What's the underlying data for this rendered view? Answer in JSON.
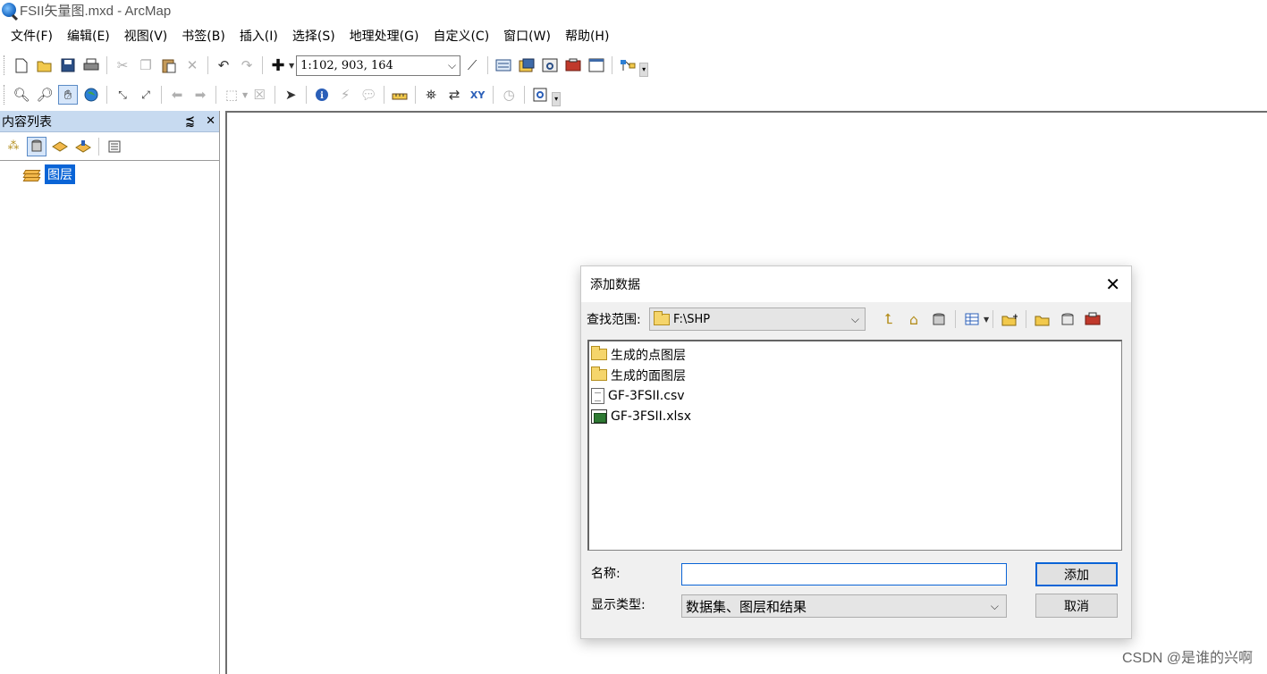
{
  "window": {
    "title": "FSII矢量图.mxd - ArcMap"
  },
  "menu": [
    "文件(F)",
    "编辑(E)",
    "视图(V)",
    "书签(B)",
    "插入(I)",
    "选择(S)",
    "地理处理(G)",
    "自定义(C)",
    "窗口(W)",
    "帮助(H)"
  ],
  "standard_toolbar": {
    "scale": "1:102, 903, 164"
  },
  "toc": {
    "title": "内容列表",
    "pin": "⪷",
    "close": "✕",
    "layer_label": "图层"
  },
  "dialog": {
    "title": "添加数据",
    "look_in_label": "查找范围:",
    "look_in_path": "F:\\SHP",
    "files": [
      {
        "name": "生成的点图层",
        "icon": "folder-icon"
      },
      {
        "name": "生成的面图层",
        "icon": "folder-icon"
      },
      {
        "name": "GF-3FSII.csv",
        "icon": "text-file-icon"
      },
      {
        "name": "GF-3FSII.xlsx",
        "icon": "table-file-icon"
      }
    ],
    "name_label": "名称:",
    "name_value": "",
    "type_label": "显示类型:",
    "type_value": "数据集、图层和结果",
    "add_button": "添加",
    "cancel_button": "取消"
  },
  "watermark": "CSDN @是谁的兴啊"
}
